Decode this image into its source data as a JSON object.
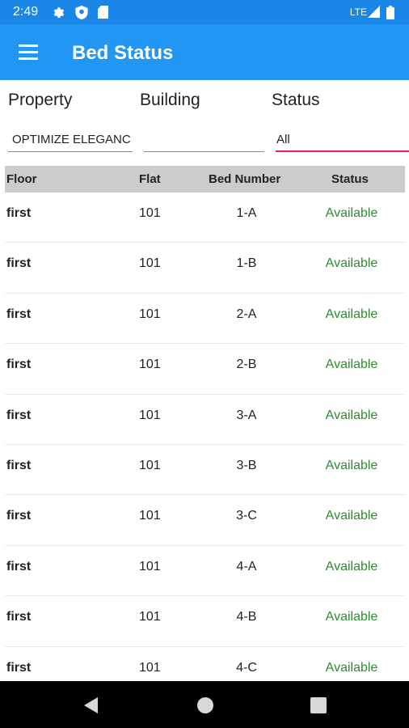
{
  "status_bar": {
    "time": "2:49",
    "network": "LTE",
    "icons": [
      "gear-icon",
      "shield-icon",
      "sim-card-icon",
      "signal-icon",
      "battery-icon"
    ]
  },
  "app_bar": {
    "title": "Bed Status",
    "menu_icon": "hamburger-menu-icon",
    "background": "#2196F3"
  },
  "filters": {
    "property_label": "Property",
    "building_label": "Building",
    "status_label": "Status",
    "property_value": "OPTIMIZE ELEGANC",
    "building_value": "",
    "status_value": "All",
    "active_underline_color": "#E91E63"
  },
  "table": {
    "headers": {
      "floor": "Floor",
      "flat": "Flat",
      "bed_number": "Bed Number",
      "status": "Status"
    },
    "rows": [
      {
        "floor": "first",
        "flat": "101",
        "bed": "1-A",
        "status": "Available"
      },
      {
        "floor": "first",
        "flat": "101",
        "bed": "1-B",
        "status": "Available"
      },
      {
        "floor": "first",
        "flat": "101",
        "bed": "2-A",
        "status": "Available"
      },
      {
        "floor": "first",
        "flat": "101",
        "bed": "2-B",
        "status": "Available"
      },
      {
        "floor": "first",
        "flat": "101",
        "bed": "3-A",
        "status": "Available"
      },
      {
        "floor": "first",
        "flat": "101",
        "bed": "3-B",
        "status": "Available"
      },
      {
        "floor": "first",
        "flat": "101",
        "bed": "3-C",
        "status": "Available"
      },
      {
        "floor": "first",
        "flat": "101",
        "bed": "4-A",
        "status": "Available"
      },
      {
        "floor": "first",
        "flat": "101",
        "bed": "4-B",
        "status": "Available"
      },
      {
        "floor": "first",
        "flat": "101",
        "bed": "4-C",
        "status": "Available"
      }
    ],
    "status_color": "#2E8B2E"
  },
  "nav_bar": {
    "icons": [
      "back-icon",
      "home-icon",
      "recents-icon"
    ]
  }
}
